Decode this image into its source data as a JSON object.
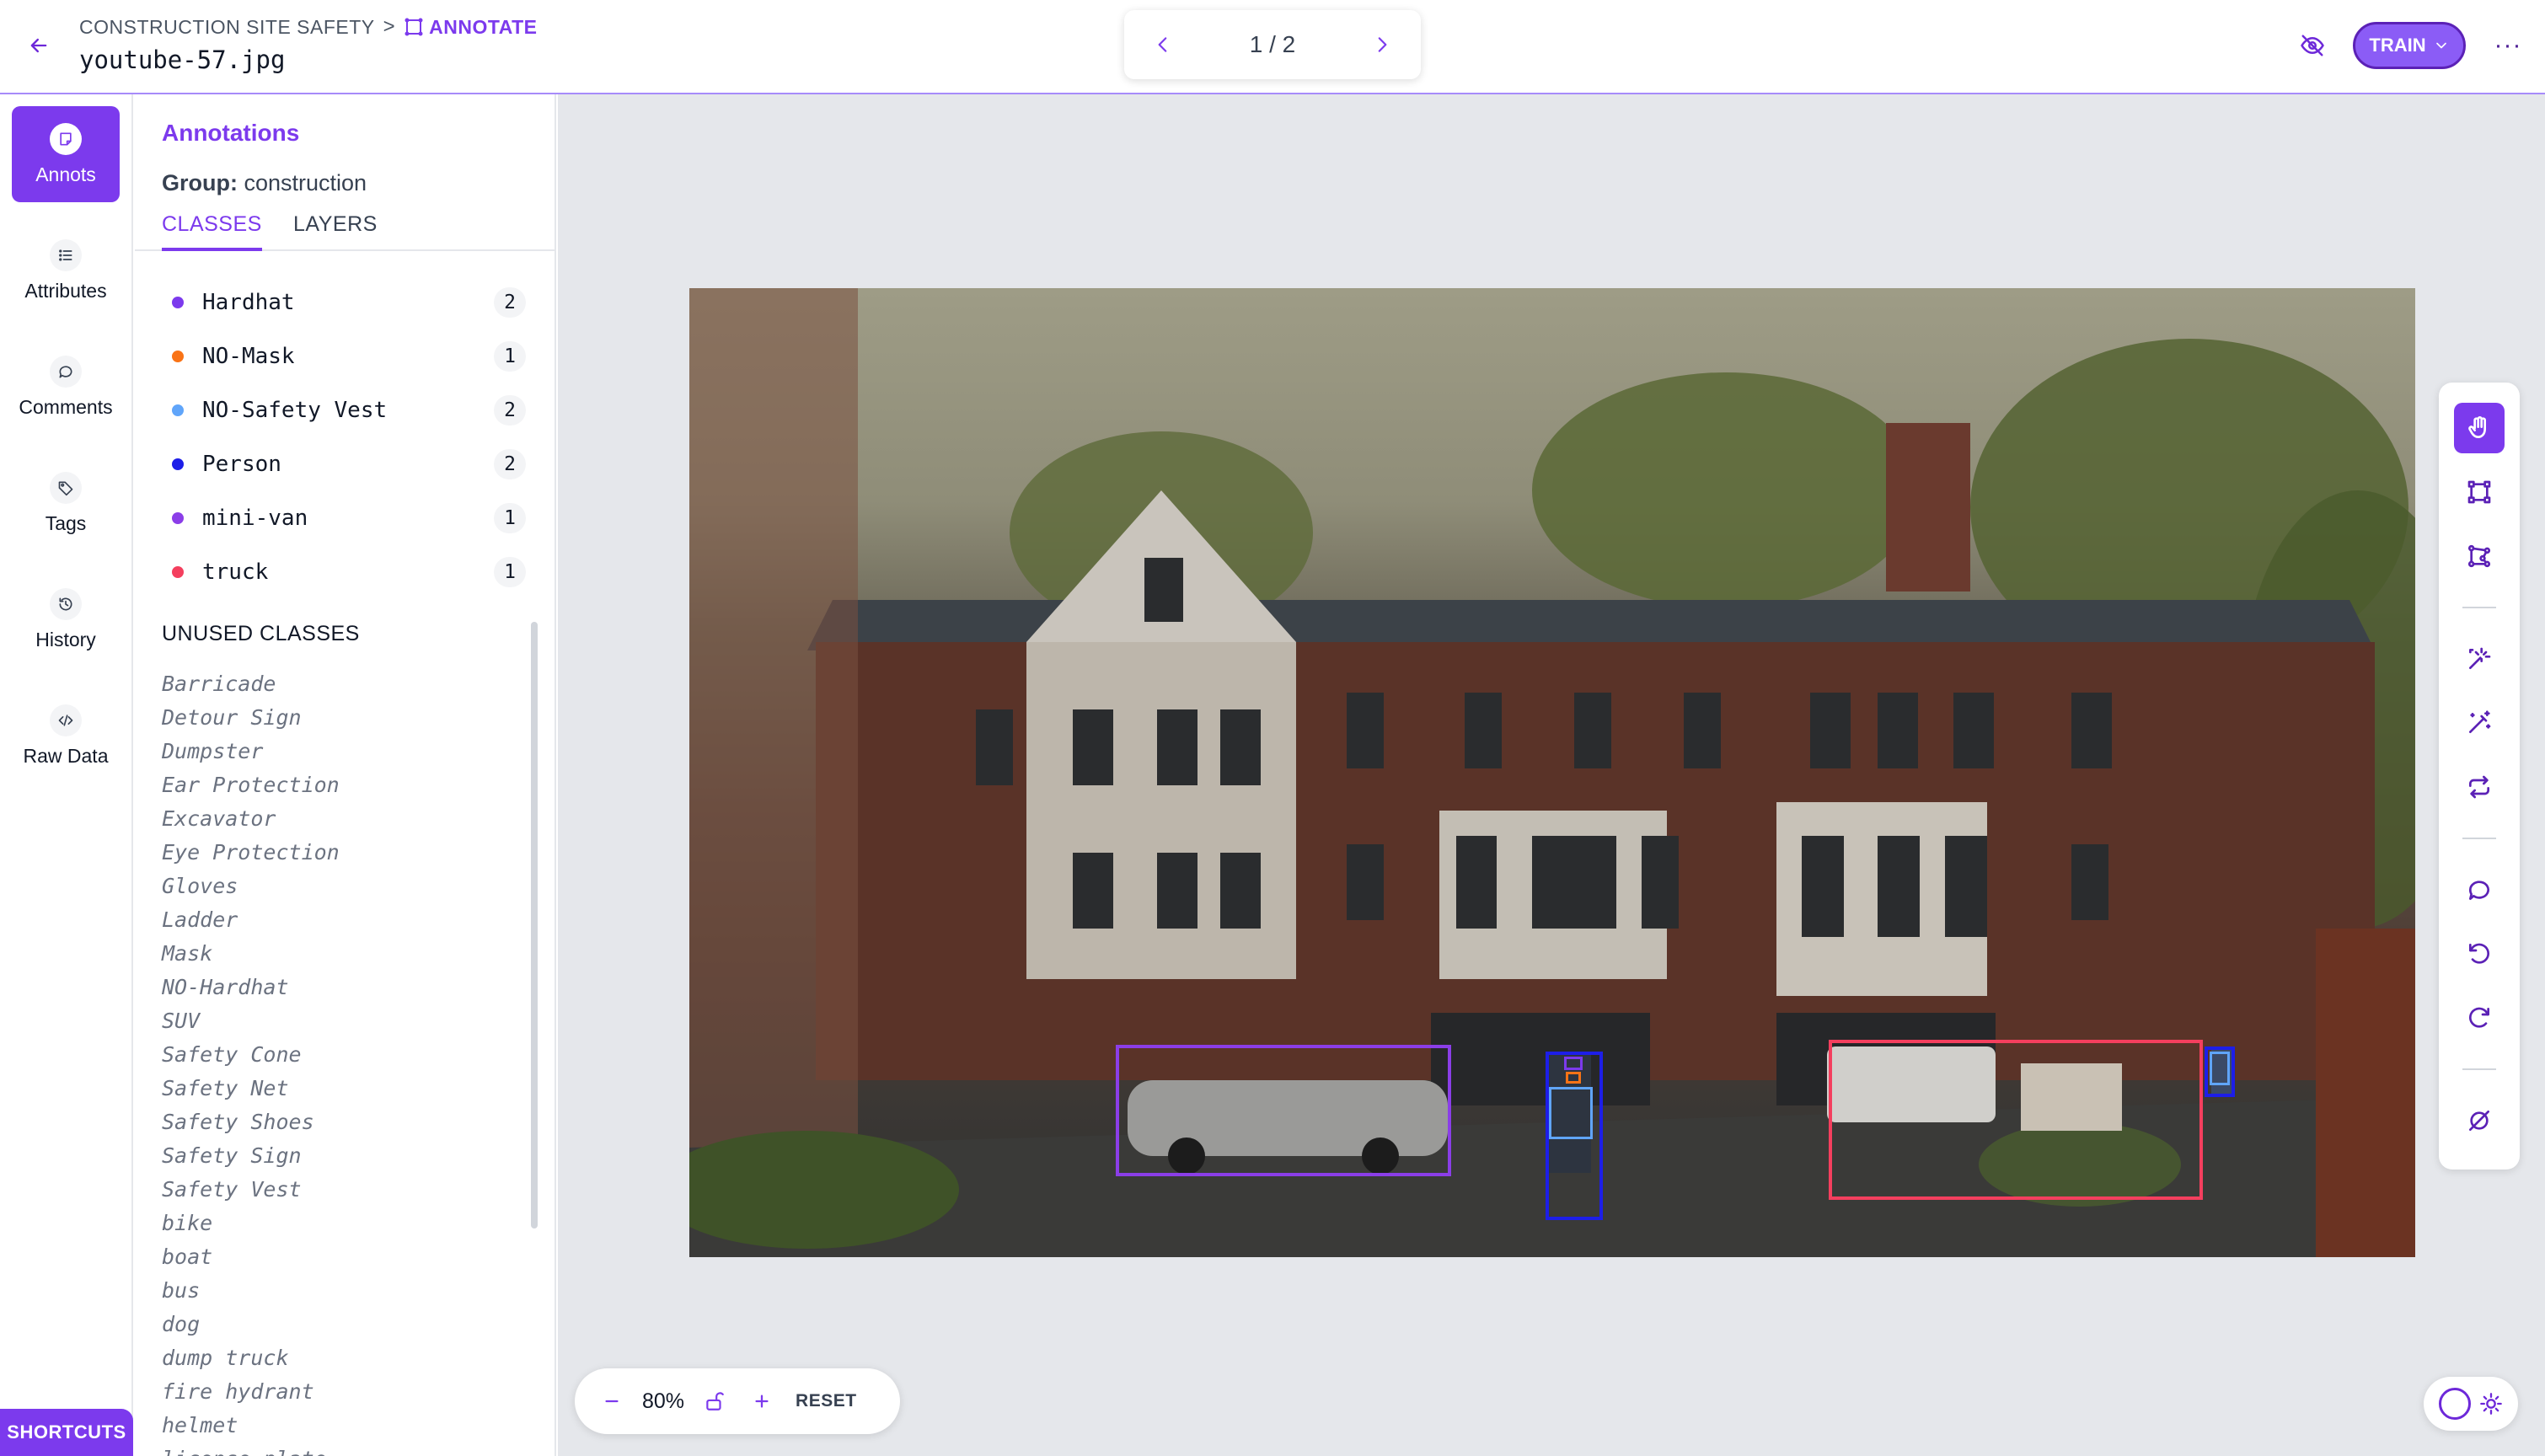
{
  "header": {
    "breadcrumb_project": "CONSTRUCTION SITE SAFETY",
    "breadcrumb_separator": ">",
    "breadcrumb_current": "ANNOTATE",
    "file_name": "youtube-57.jpg",
    "pager_text": "1 / 2",
    "train_label": "TRAIN",
    "more_label": "···"
  },
  "rail": {
    "items": [
      {
        "label": "Annots",
        "icon": "annotation-icon",
        "active": true
      },
      {
        "label": "Attributes",
        "icon": "list-icon"
      },
      {
        "label": "Comments",
        "icon": "comment-icon"
      },
      {
        "label": "Tags",
        "icon": "tag-icon"
      },
      {
        "label": "History",
        "icon": "history-icon"
      },
      {
        "label": "Raw Data",
        "icon": "code-icon"
      }
    ],
    "shortcuts_label": "SHORTCUTS"
  },
  "panel": {
    "title": "Annotations",
    "group_label": "Group:",
    "group_value": "construction",
    "tabs": [
      "CLASSES",
      "LAYERS"
    ],
    "active_tab": "CLASSES",
    "classes": [
      {
        "name": "Hardhat",
        "count": "2",
        "color": "#7c3aed"
      },
      {
        "name": "NO-Mask",
        "count": "1",
        "color": "#f97316"
      },
      {
        "name": "NO-Safety Vest",
        "count": "2",
        "color": "#60a5fa"
      },
      {
        "name": "Person",
        "count": "2",
        "color": "#1d1ee8"
      },
      {
        "name": "mini-van",
        "count": "1",
        "color": "#8b3ee8"
      },
      {
        "name": "truck",
        "count": "1",
        "color": "#f43f5e"
      }
    ],
    "unused_title": "UNUSED CLASSES",
    "unused_classes": [
      "Barricade",
      "Detour Sign",
      "Dumpster",
      "Ear Protection",
      "Excavator",
      "Eye Protection",
      "Gloves",
      "Ladder",
      "Mask",
      "NO-Hardhat",
      "SUV",
      "Safety Cone",
      "Safety Net",
      "Safety Shoes",
      "Safety Sign",
      "Safety Vest",
      "bike",
      "boat",
      "bus",
      "dog",
      "dump truck",
      "fire hydrant",
      "helmet",
      "license plate"
    ]
  },
  "annotations": [
    {
      "class": "mini-van",
      "color": "#8b3ee8"
    },
    {
      "class": "Person",
      "color": "#1d1ee8"
    },
    {
      "class": "NO-Safety Vest",
      "color": "#60a5fa"
    },
    {
      "class": "Hardhat",
      "color": "#7c3aed"
    },
    {
      "class": "NO-Mask",
      "color": "#f97316"
    },
    {
      "class": "truck",
      "color": "#f43f5e"
    },
    {
      "class": "Person",
      "color": "#1d1ee8"
    },
    {
      "class": "NO-Safety Vest",
      "color": "#60a5fa"
    }
  ],
  "toolbar": {
    "tools": [
      "drag-hand-icon",
      "bounding-box-icon",
      "polygon-icon",
      "smart-polygon-icon",
      "magic-wand-icon",
      "repeat-previous-icon",
      "comment-icon",
      "undo-icon",
      "redo-icon",
      "clear-icon"
    ],
    "active_tool": "drag-hand-icon"
  },
  "zoom": {
    "value": "80%",
    "reset_label": "RESET"
  },
  "colors": {
    "accent": "#7c3aed",
    "header_border": "#a78bfa"
  }
}
